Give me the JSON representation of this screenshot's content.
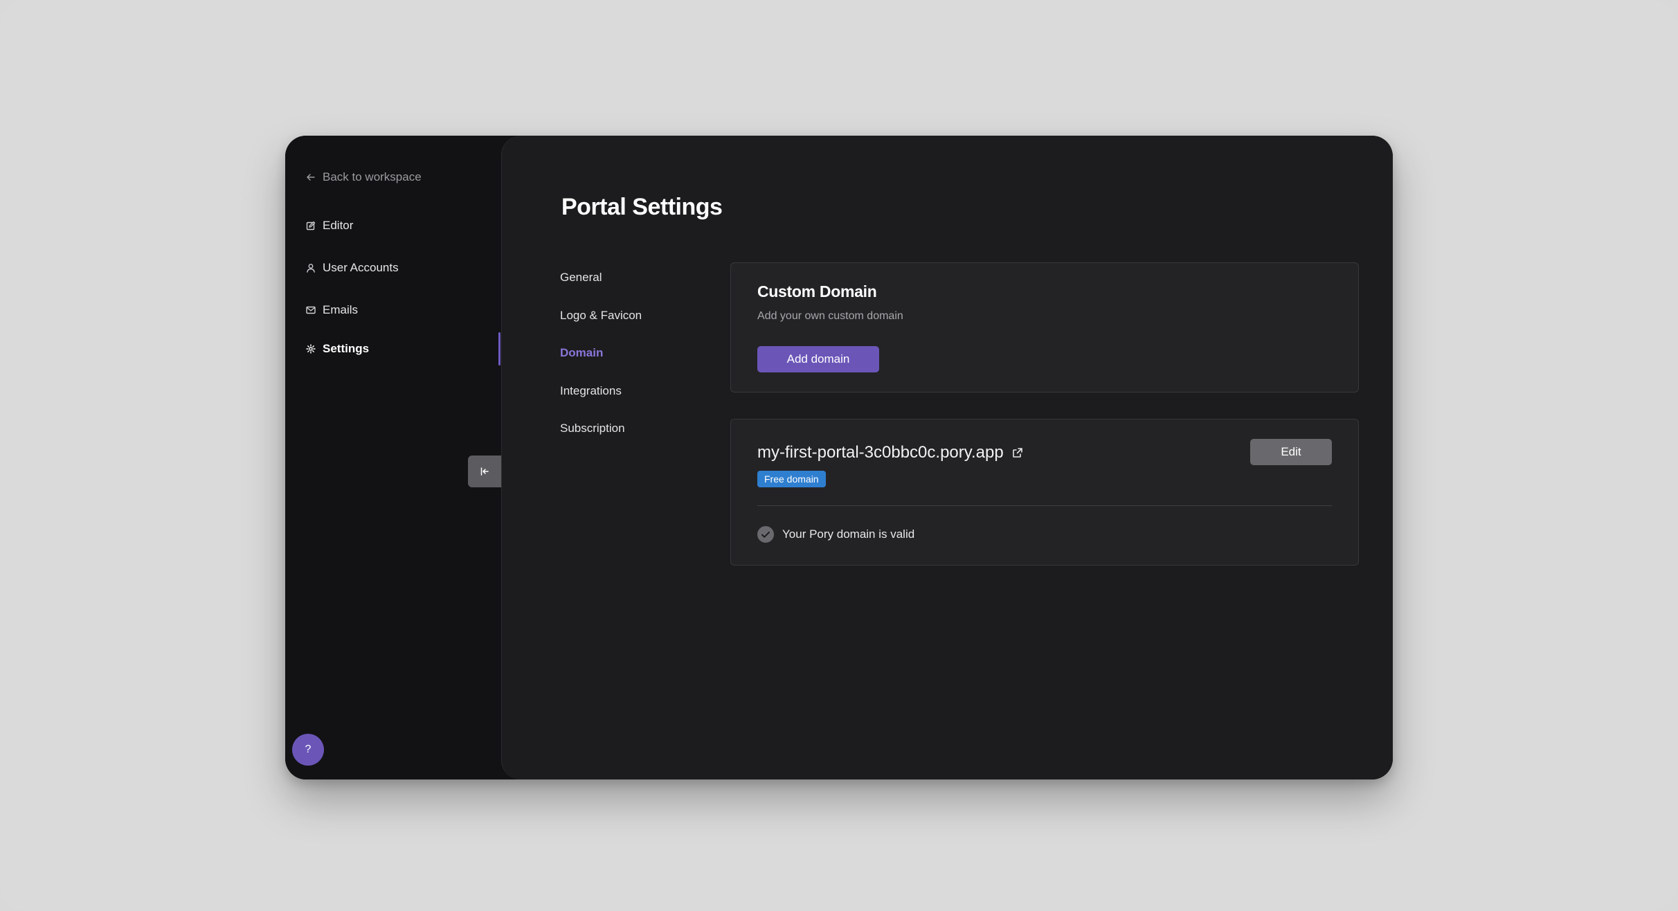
{
  "sidebar": {
    "back_label": "Back to workspace",
    "items": [
      {
        "label": "Editor",
        "icon": "edit-icon"
      },
      {
        "label": "User Accounts",
        "icon": "user-icon"
      },
      {
        "label": "Emails",
        "icon": "mail-icon"
      },
      {
        "label": "Settings",
        "icon": "gear-icon",
        "active": true
      }
    ],
    "collapse_icon": "collapse-left-icon",
    "help_label": "?"
  },
  "main": {
    "title": "Portal Settings",
    "sub_nav": [
      {
        "label": "General"
      },
      {
        "label": "Logo & Favicon"
      },
      {
        "label": "Domain",
        "active": true
      },
      {
        "label": "Integrations"
      },
      {
        "label": "Subscription"
      }
    ],
    "custom_domain": {
      "title": "Custom Domain",
      "description": "Add your own custom domain",
      "button_label": "Add domain"
    },
    "domain_card": {
      "domain": "my-first-portal-3c0bbc0c.pory.app",
      "badge": "Free domain",
      "edit_label": "Edit",
      "status": "Your Pory domain is valid"
    }
  },
  "colors": {
    "accent": "#6b56b8",
    "accent_text": "#8a76d8",
    "badge_blue": "#2f7fd0",
    "window_bg": "#121214",
    "panel_bg": "#1c1c1e",
    "card_bg": "#232325"
  }
}
